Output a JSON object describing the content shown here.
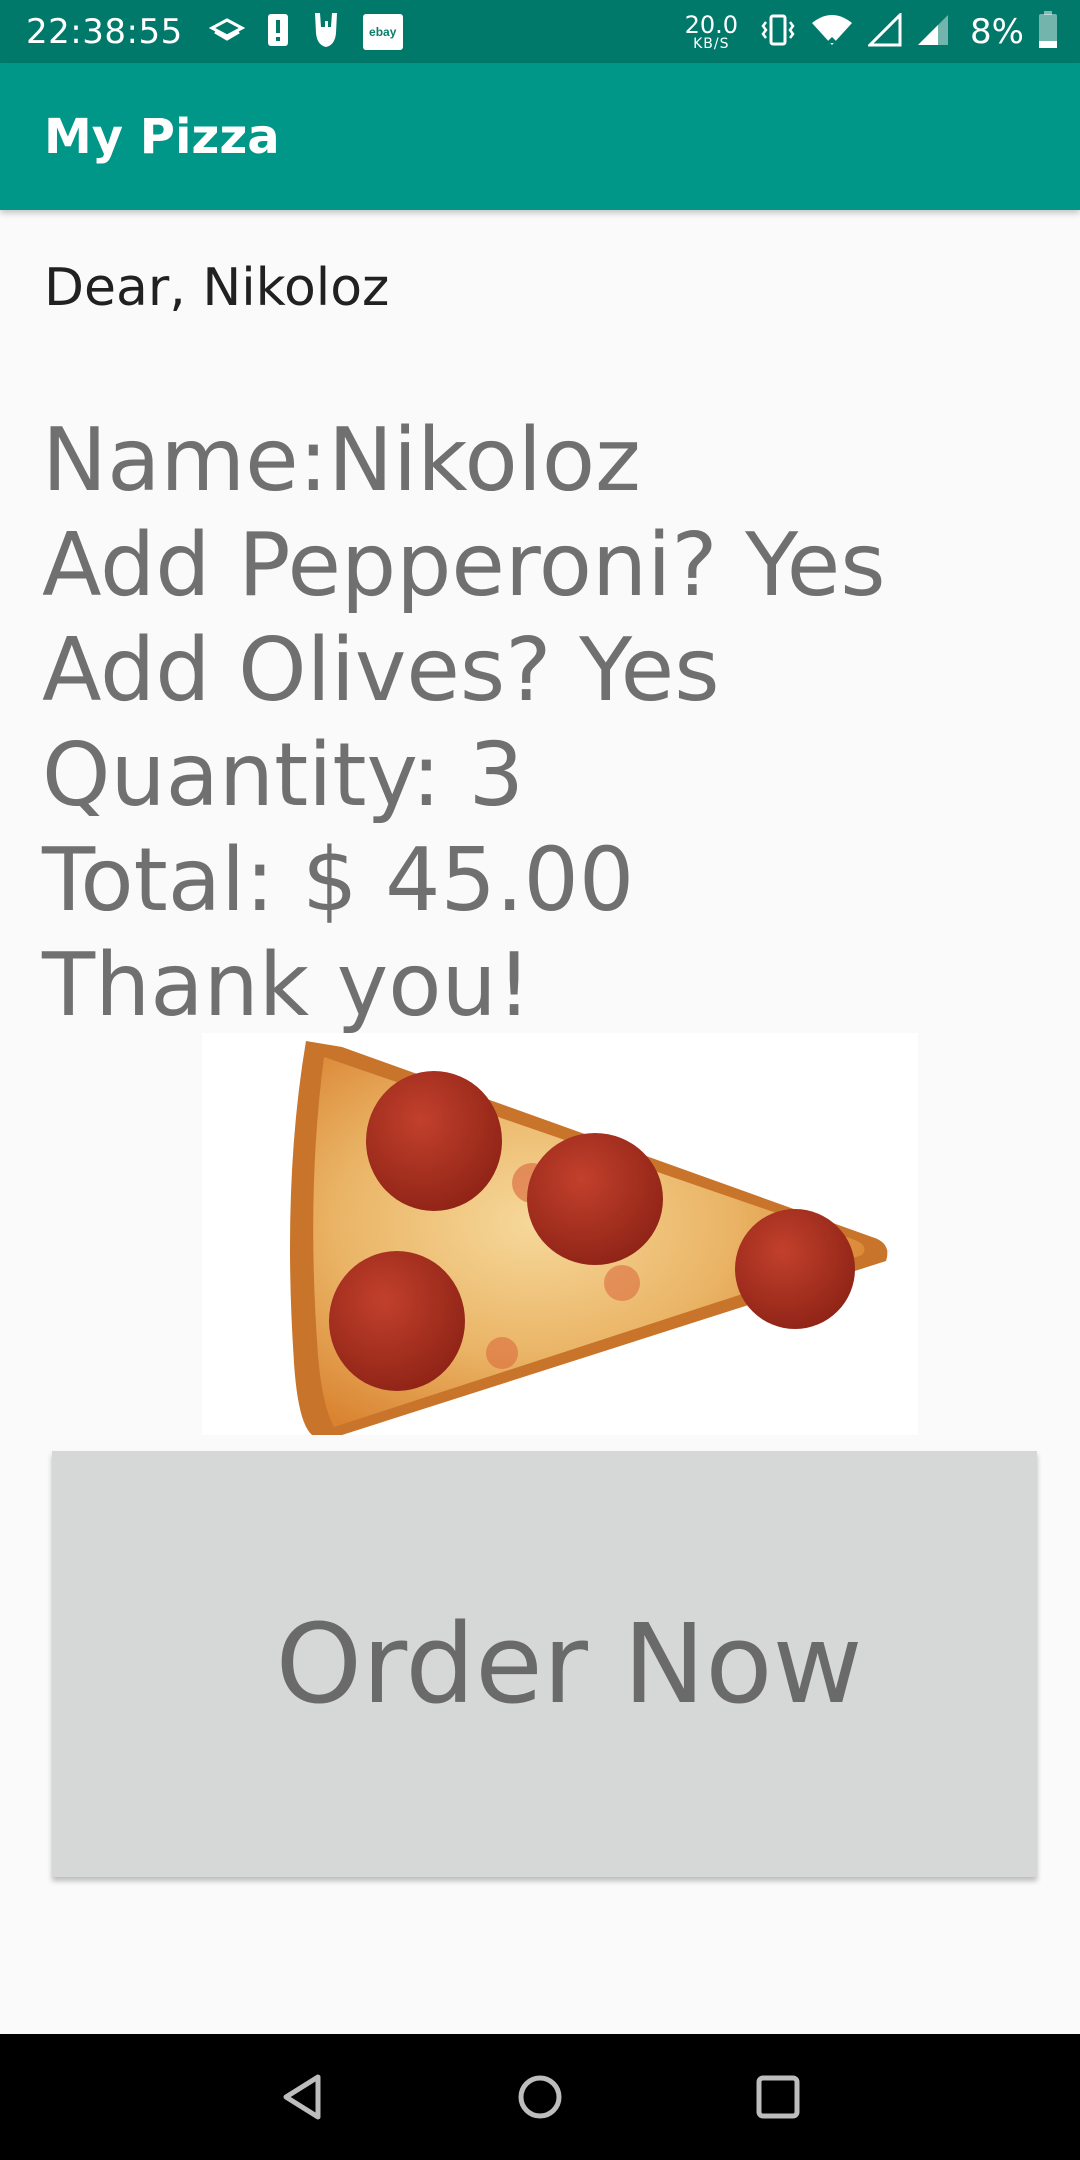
{
  "status_bar": {
    "time": "22:38:55",
    "ebay_label": "ebay",
    "net_speed_value": "20.0",
    "net_speed_unit": "KB/S",
    "battery_percent": "8%",
    "left_icons": [
      "layers-icon",
      "alert-icon",
      "rock-hand-icon",
      "ebay-icon"
    ],
    "right_icons": [
      "vibrate-icon",
      "wifi-icon",
      "signal-empty-icon",
      "signal-icon",
      "battery-icon"
    ]
  },
  "app_bar": {
    "title": "My Pizza"
  },
  "order": {
    "greeting": "Dear, Nikoloz",
    "lines": [
      "Name:Nikoloz",
      "Add Pepperoni? Yes",
      "Add Olives? Yes",
      "Quantity: 3",
      "Total: $ 45.00",
      "Thank you!"
    ]
  },
  "image": {
    "name": "pizza-slice-image"
  },
  "button": {
    "label": "Order Now"
  },
  "colors": {
    "status_bar": "#00796b",
    "app_bar": "#009688",
    "background": "#fafafa",
    "summary_text": "#707070",
    "button_bg": "#d6d7d7",
    "button_text": "#6a6a6a"
  },
  "nav_bar": {
    "icons": [
      "back-icon",
      "home-icon",
      "recents-icon"
    ]
  }
}
